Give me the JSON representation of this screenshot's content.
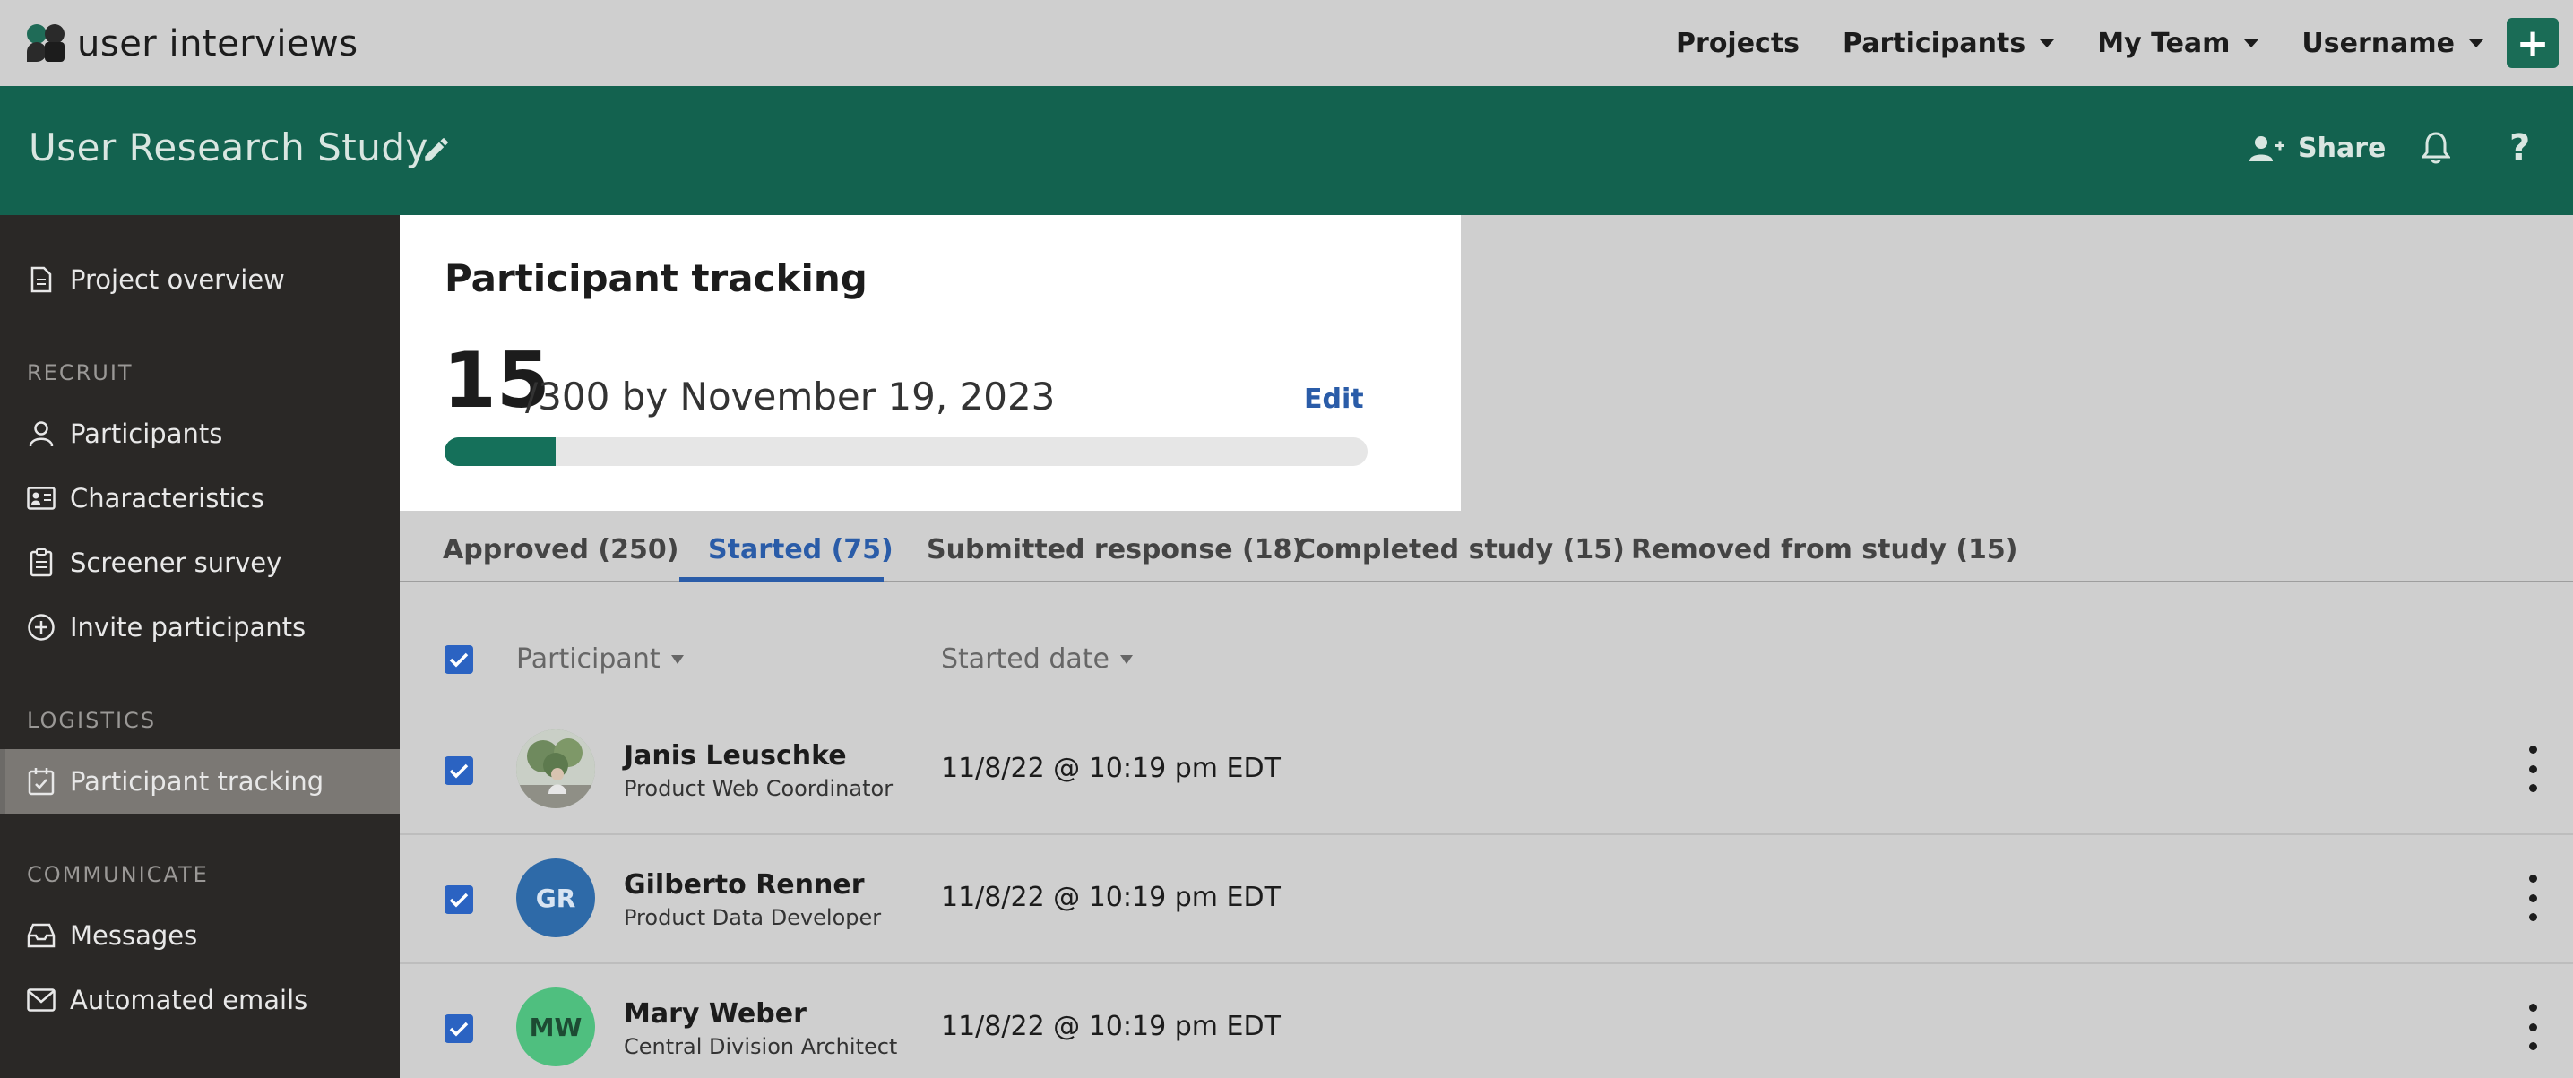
{
  "app": {
    "logo_text": "user interviews"
  },
  "topnav": {
    "projects": "Projects",
    "participants": "Participants",
    "my_team": "My Team",
    "username": "Username",
    "add": "+"
  },
  "header": {
    "study_title": "User Research Study",
    "share": "Share",
    "help": "?"
  },
  "sidebar": {
    "project_overview": "Project overview",
    "recruit_section": "RECRUIT",
    "recruit_items": [
      "Participants",
      "Characteristics",
      "Screener survey",
      "Invite participants"
    ],
    "logistics_section": "LOGISTICS",
    "participant_tracking": "Participant tracking",
    "communicate_section": "COMMUNICATE",
    "communicate_items": [
      "Messages",
      "Automated emails"
    ]
  },
  "tracking": {
    "title": "Participant tracking",
    "count": "15",
    "target_text": "/300 by November 19, 2023",
    "edit": "Edit",
    "progress_fraction": 0.05
  },
  "tabs": [
    {
      "label": "Approved (250)",
      "active": false
    },
    {
      "label": "Started (75)",
      "active": true
    },
    {
      "label": "Submitted response (18)",
      "active": false
    },
    {
      "label": "Completed study (15)",
      "active": false
    },
    {
      "label": "Removed from study (15)",
      "active": false
    }
  ],
  "table": {
    "col_participant": "Participant",
    "col_started": "Started date",
    "rows": [
      {
        "name": "Janis Leuschke",
        "role": "Product Web Coordinator",
        "date": "11/8/22 @ 10:19 pm EDT",
        "initials": "",
        "avatar": "photo"
      },
      {
        "name": "Gilberto Renner",
        "role": "Product Data Developer",
        "date": "11/8/22 @ 10:19 pm EDT",
        "initials": "GR",
        "avatar_color": "#2e6aa8"
      },
      {
        "name": "Mary Weber",
        "role": "Central Division Architect",
        "date": "11/8/22 @ 10:19 pm EDT",
        "initials": "MW",
        "avatar_color": "#4fbf7f"
      }
    ]
  },
  "colors": {
    "brand_green": "#13624f",
    "accent_blue": "#2a5ca8",
    "sidebar_bg": "#2a2826"
  }
}
